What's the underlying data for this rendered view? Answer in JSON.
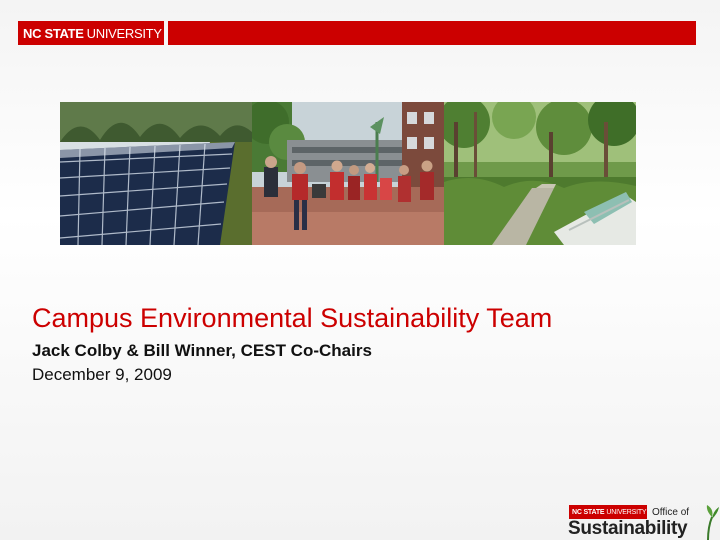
{
  "header": {
    "brand_strong": "NC STATE",
    "brand_light": "UNIVERSITY",
    "accent_color": "#cc0000"
  },
  "photos": [
    {
      "subject": "solar-panels-icon"
    },
    {
      "subject": "students-walking-icon"
    },
    {
      "subject": "greenway-trail-icon"
    }
  ],
  "slide": {
    "title": "Campus Environmental Sustainability Team",
    "subtitle": "Jack Colby & Bill Winner, CEST Co-Chairs",
    "date": "December 9, 2009"
  },
  "footer_logo": {
    "brand_strong": "NC STATE",
    "brand_light": "UNIVERSITY",
    "office": "Office of",
    "sustainability": "Sustainability"
  }
}
